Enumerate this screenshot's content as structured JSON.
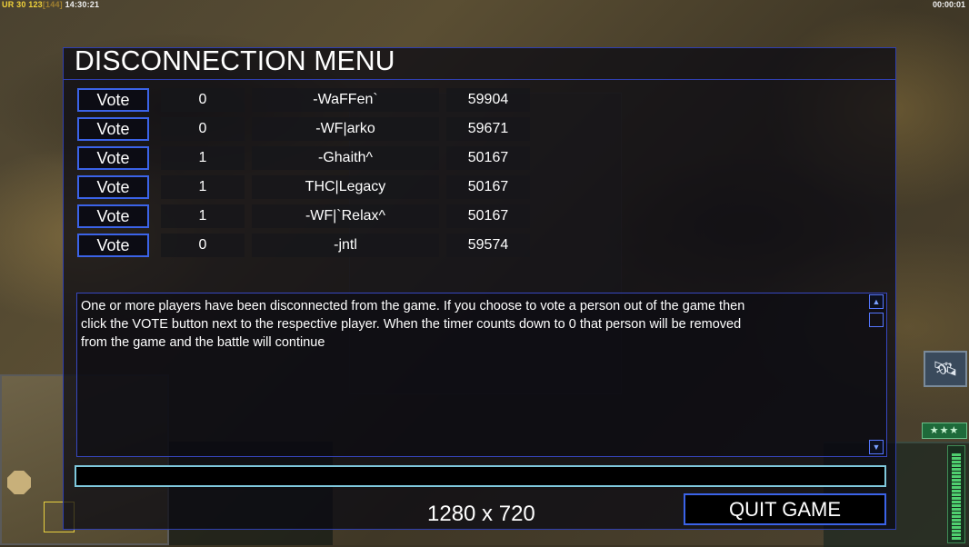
{
  "hud": {
    "ur_label": "UR",
    "ur_value": "30",
    "frame_value": "123",
    "frame_cap": "[144]",
    "clock": "14:30:21",
    "timer": "00:00:01"
  },
  "dialog": {
    "title": "DISCONNECTION MENU",
    "vote_label": "Vote",
    "players": [
      {
        "votes": "0",
        "name": "-WaFFen`",
        "ping": "59904"
      },
      {
        "votes": "0",
        "name": "-WF|arko",
        "ping": "59671"
      },
      {
        "votes": "1",
        "name": "-Ghaith^",
        "ping": "50167"
      },
      {
        "votes": "1",
        "name": "THC|Legacy",
        "ping": "50167"
      },
      {
        "votes": "1",
        "name": "-WF|`Relax^",
        "ping": "50167"
      },
      {
        "votes": "0",
        "name": "-jntl",
        "ping": "59574"
      }
    ],
    "message": "One or more players have been disconnected from the game. If you choose to vote a person out of the game then\n click the VOTE button next to the respective player. When the timer counts down to 0 that person will be removed\n from the game and the battle will continue",
    "chat_value": "",
    "resolution_label": "1280 x 720",
    "quit_label": "QUIT GAME"
  },
  "icons": {
    "scroll_up": "triangle-up-icon",
    "scroll_down": "triangle-down-icon",
    "satellite": "satellite-icon",
    "stars": "rank-stars-icon"
  },
  "colors": {
    "accent_blue": "#3b63e8",
    "chat_border": "#7fc8dc",
    "text": "#ffffff",
    "hud_yellow": "#f0d23a"
  }
}
